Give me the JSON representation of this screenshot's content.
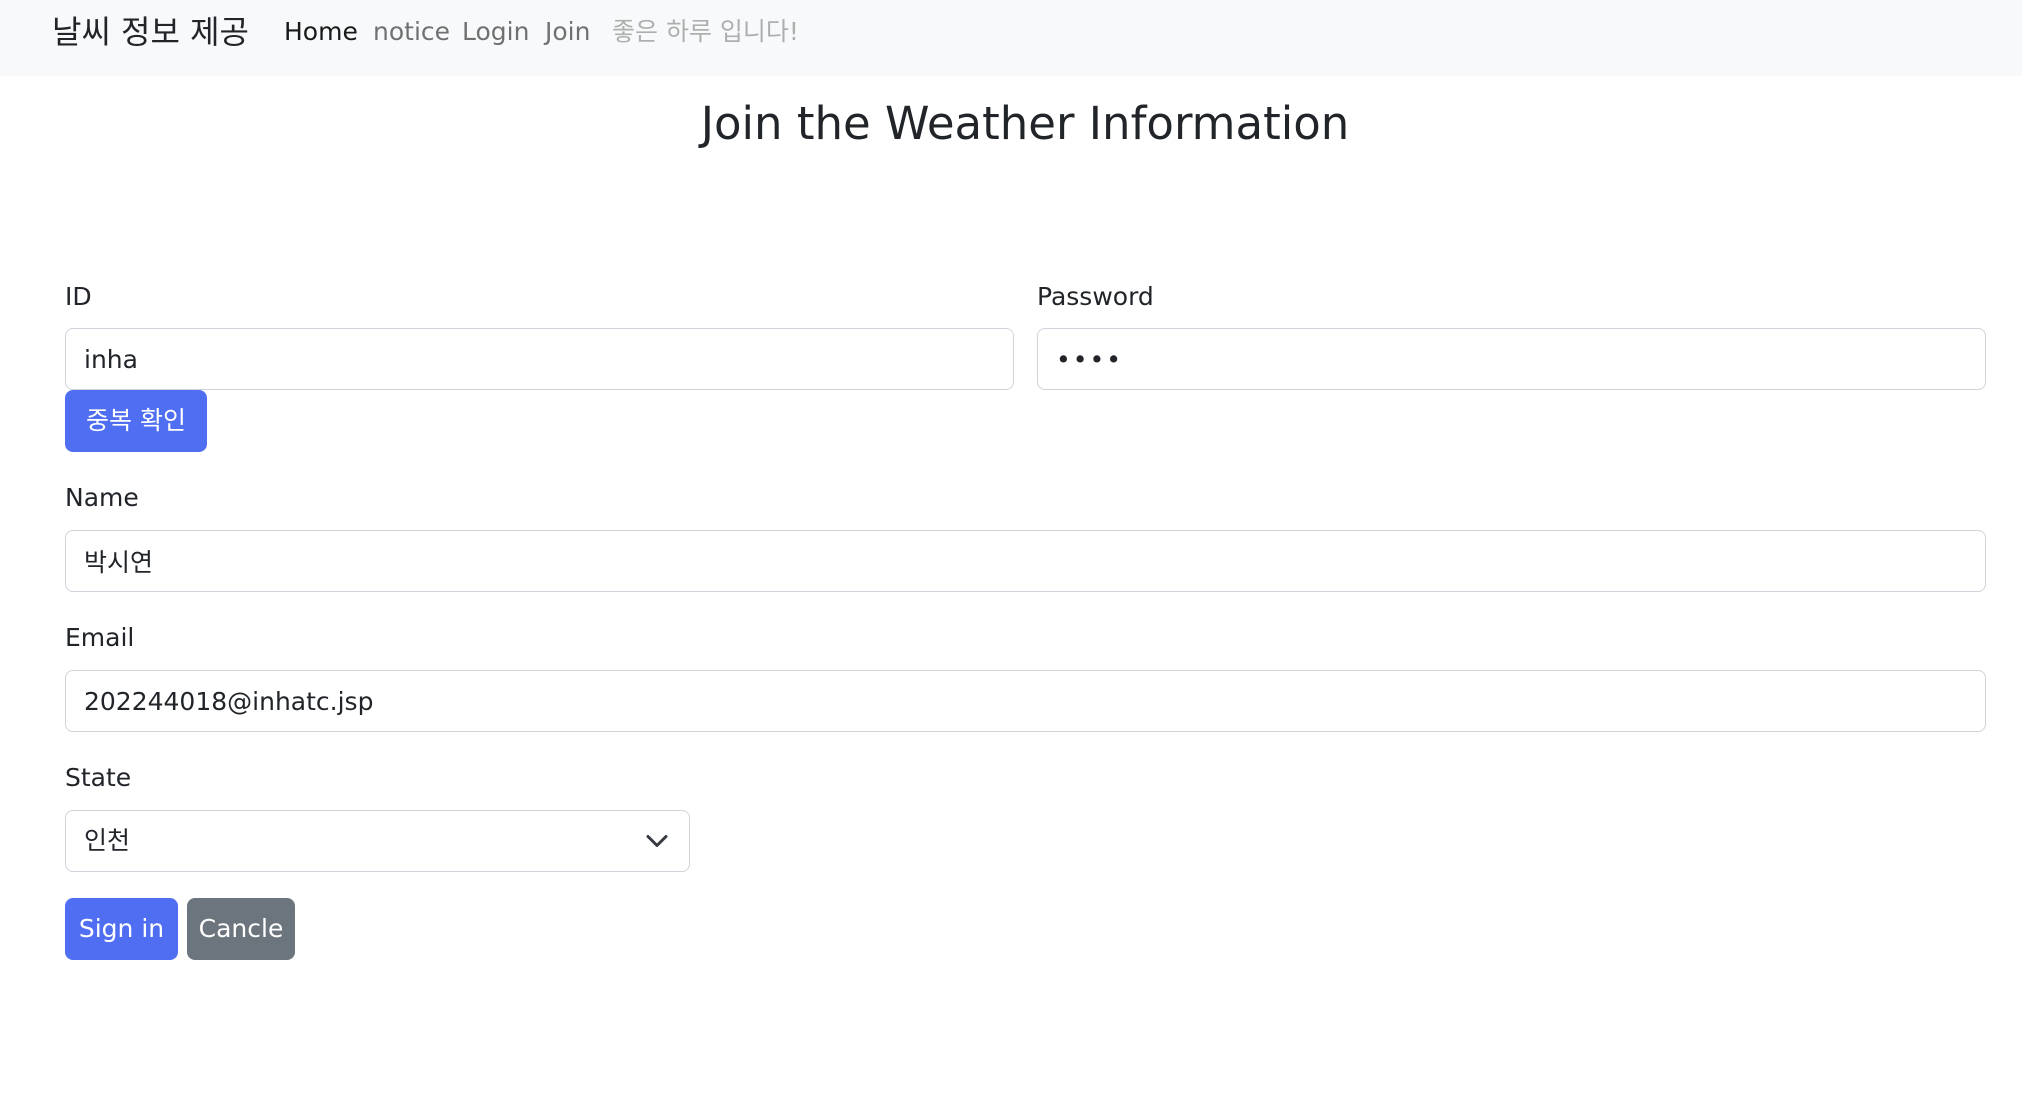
{
  "navbar": {
    "brand": "날씨 정보 제공",
    "items": [
      {
        "label": "Home"
      },
      {
        "label": "notice"
      },
      {
        "label": "Login"
      },
      {
        "label": "Join"
      },
      {
        "label": "좋은 하루 입니다!"
      }
    ]
  },
  "page": {
    "title": "Join the Weather Information"
  },
  "form": {
    "id": {
      "label": "ID",
      "value": "inha"
    },
    "password": {
      "label": "Password",
      "value": "••••"
    },
    "check_button": "중복 확인",
    "name": {
      "label": "Name",
      "value": "박시연"
    },
    "email": {
      "label": "Email",
      "value": "202244018@inhatc.jsp"
    },
    "state": {
      "label": "State",
      "value": "인천"
    },
    "submit_button": "Sign in",
    "cancel_button": "Cancle"
  },
  "colors": {
    "primary": "#4f6ef2",
    "secondary": "#6c757d",
    "navbar_bg": "#f8f9fa"
  },
  "icons": {
    "select_arrow": "chevron-down-icon"
  }
}
